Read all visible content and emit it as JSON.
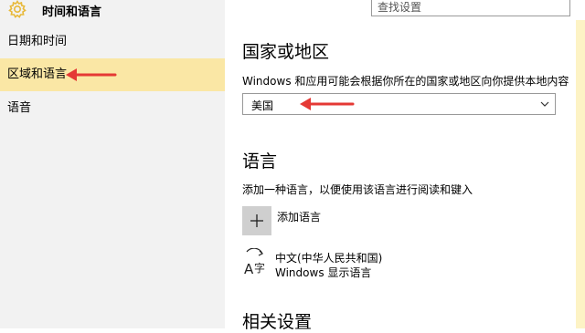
{
  "header": {
    "title": "时间和语言",
    "icon": "gear-icon"
  },
  "search": {
    "placeholder": "查找设置"
  },
  "sidebar": {
    "items": [
      {
        "label": "日期和时间"
      },
      {
        "label": "区域和语言",
        "selected": true
      },
      {
        "label": "语音"
      }
    ]
  },
  "region": {
    "heading": "国家或地区",
    "description": "Windows 和应用可能会根据你所在的国家或地区向你提供本地内容",
    "selected_value": "美国"
  },
  "language": {
    "heading": "语言",
    "description": "添加一种语言，以便使用该语言进行阅读和键入",
    "add_label": "添加语言",
    "items": [
      {
        "name": "中文(中华人民共和国)",
        "subtitle": "Windows 显示语言"
      }
    ]
  },
  "related": {
    "heading": "相关设置"
  },
  "colors": {
    "accent": "#f0c94a",
    "selected_bg": "#fae7a5",
    "sidebar_bg": "#f2f2f2",
    "annotation_red": "#e53935"
  }
}
